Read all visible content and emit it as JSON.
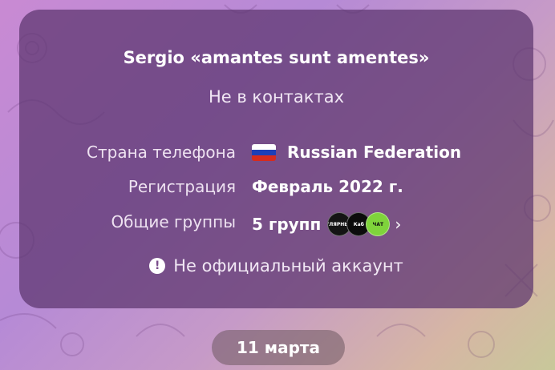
{
  "card": {
    "title": "Sergio «amantes sunt amentes»",
    "subtitle": "Не в контактах",
    "rows": [
      {
        "label": "Страна телефона",
        "value": "Russian Federation",
        "flag_icon": "russia-flag-icon"
      },
      {
        "label": "Регистрация",
        "value": "Февраль 2022 г."
      },
      {
        "label": "Общие группы",
        "value": "5 групп"
      }
    ],
    "group_avatars": [
      {
        "text": "ПОПУЛЯРНЫЙ ЧАТ",
        "bg": "#141414"
      },
      {
        "text": "Каб",
        "bg": "#0c0c0c"
      },
      {
        "text": "ЧАТ",
        "bg": "#7fd43b"
      }
    ],
    "warning_icon": "exclamation-circle-icon",
    "warning": "Не официальный аккаунт"
  },
  "date_separator": "11 марта",
  "colors": {
    "card_bg": "#5c346e",
    "flag_white": "#ffffff",
    "flag_blue": "#1c3fb8",
    "flag_red": "#d52b1e"
  }
}
